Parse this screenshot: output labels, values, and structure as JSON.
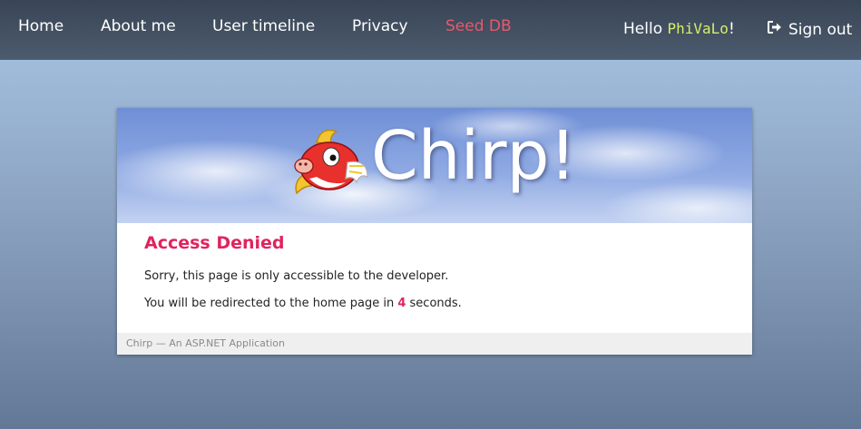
{
  "nav": {
    "items": [
      {
        "label": "Home"
      },
      {
        "label": "About me"
      },
      {
        "label": "User timeline"
      },
      {
        "label": "Privacy"
      },
      {
        "label": "Seed DB"
      }
    ],
    "hello_prefix": "Hello ",
    "username": "PhiVaLo",
    "hello_suffix": "!",
    "signout_label": "Sign out",
    "signout_icon": "sign-out-icon"
  },
  "banner": {
    "title": "Chirp!",
    "mascot_icon": "flying-fish-mascot"
  },
  "main": {
    "heading": "Access Denied",
    "message": "Sorry, this page is only accessible to the developer.",
    "redirect_prefix": "You will be redirected to the home page in ",
    "redirect_seconds": "4",
    "redirect_suffix": " seconds."
  },
  "footer": {
    "text": "Chirp — An ASP.NET Application"
  },
  "colors": {
    "accent": "#e0245e",
    "seed_link": "#e8586e",
    "username": "#d6ef6a",
    "navbar": "#444f5f"
  }
}
